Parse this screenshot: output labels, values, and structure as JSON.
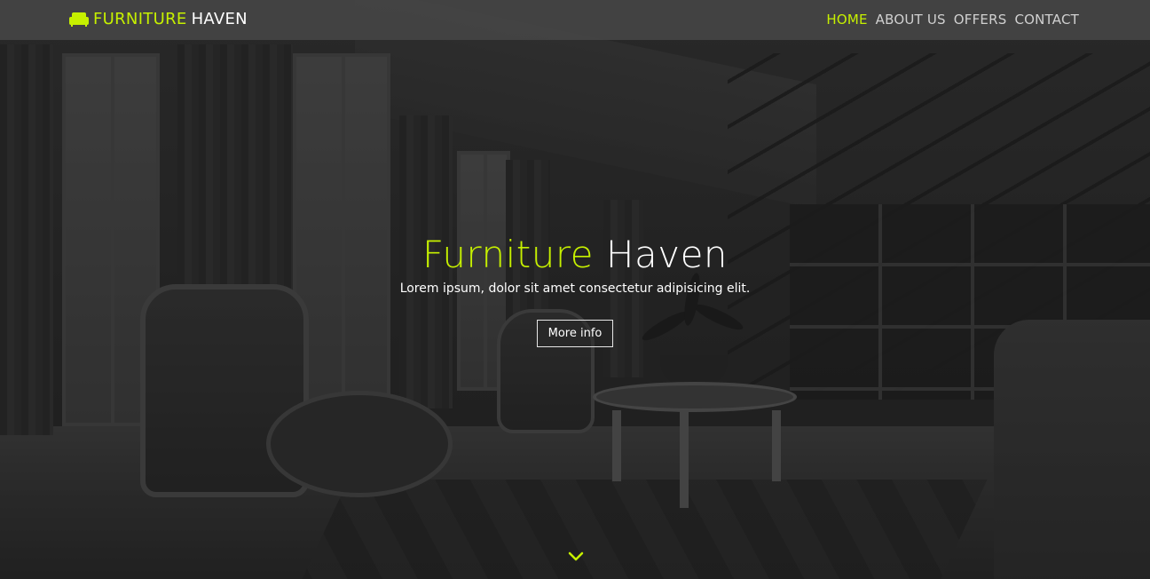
{
  "brand": {
    "accent": "FURNITURE",
    "rest": "HAVEN",
    "icon": "sofa-icon"
  },
  "nav": {
    "items": [
      {
        "label": "HOME",
        "active": true
      },
      {
        "label": "ABOUT US",
        "active": false
      },
      {
        "label": "OFFERS",
        "active": false
      },
      {
        "label": "CONTACT",
        "active": false
      }
    ]
  },
  "hero": {
    "title_accent": "Furniture",
    "title_rest": "Haven",
    "subtitle": "Lorem ipsum, dolor sit amet consectetur adipisicing elit.",
    "button_label": "More info",
    "scroll_icon": "chevron-down-icon"
  },
  "colors": {
    "accent": "#c6f000",
    "text": "#ffffff",
    "nav_text": "#d0d0d0",
    "navbar_bg": "#464646"
  }
}
